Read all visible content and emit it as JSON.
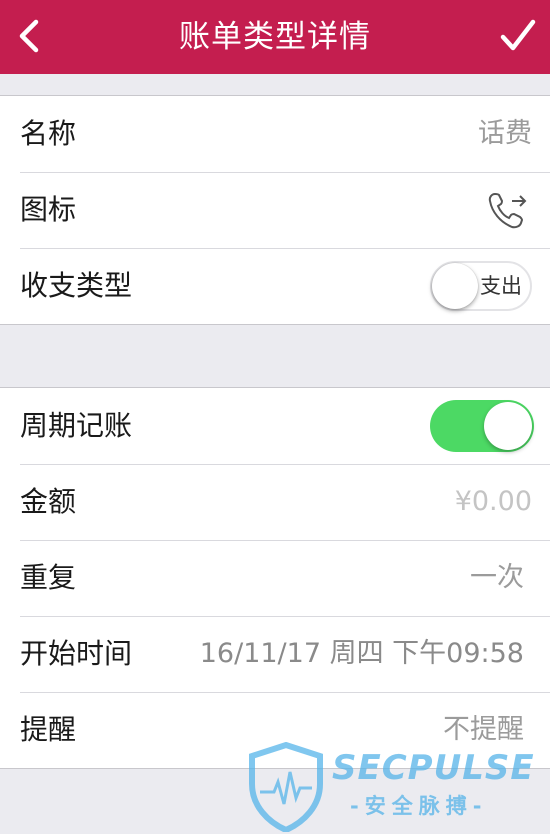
{
  "nav": {
    "title": "账单类型详情",
    "back_icon": "chevron-left-icon",
    "done_icon": "checkmark-icon",
    "bar_color": "#c41e4f"
  },
  "section1": {
    "name_label": "名称",
    "name_value": "话费",
    "icon_label": "图标",
    "icon_name": "phone-outgoing-icon",
    "type_label": "收支类型",
    "type_switch_text": "支出",
    "type_switch_on": false
  },
  "section2": {
    "recurring_label": "周期记账",
    "recurring_on": true,
    "switch_on_color": "#4cd964",
    "amount_label": "金额",
    "amount_placeholder": "¥0.00",
    "repeat_label": "重复",
    "repeat_value": "一次",
    "start_label": "开始时间",
    "start_value": "16/11/17 周四 下午09:58",
    "remind_label": "提醒",
    "remind_value": "不提醒"
  },
  "watermark": {
    "brand": "SECPULSE",
    "sub": "-安全脉搏-"
  }
}
